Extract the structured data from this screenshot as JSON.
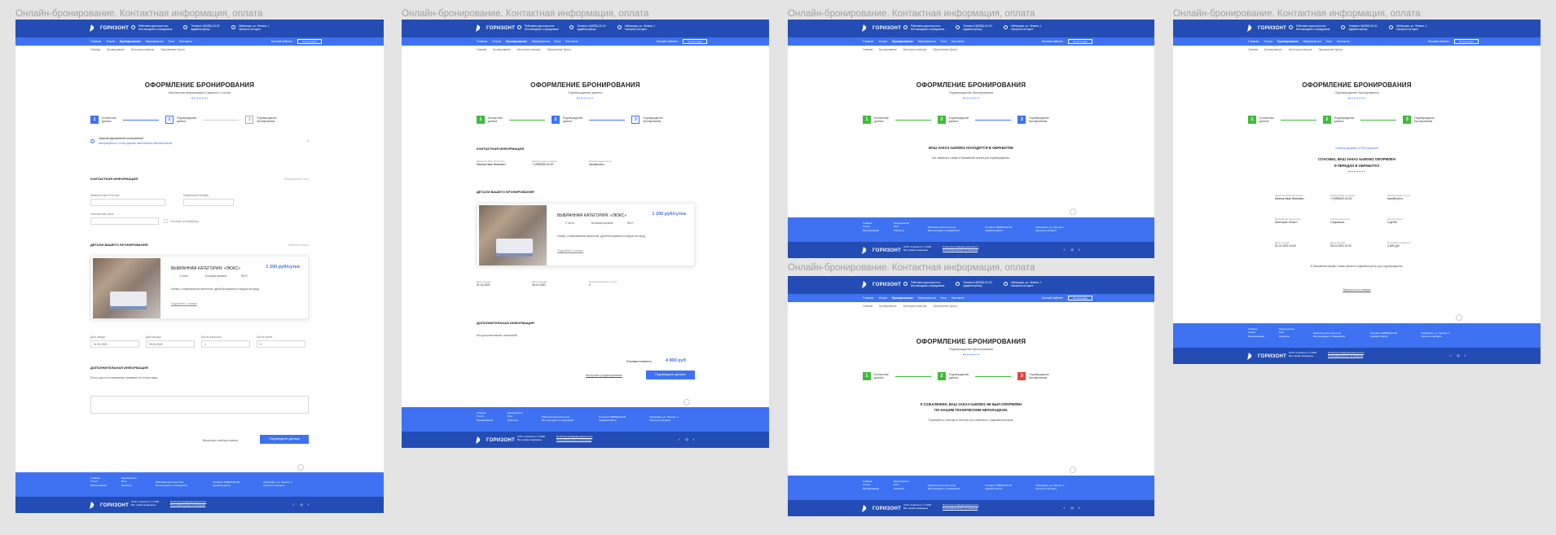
{
  "board_title": "Онлайн-бронирование. Контактная информация, оплата",
  "brand": "ГОРИЗОНТ",
  "header_contacts": [
    {
      "icon": "clock-icon",
      "lines": [
        "Работаем круглосуточно",
        "Без выходных и праздников"
      ]
    },
    {
      "icon": "phone-icon",
      "lines": [
        "Телефон: 8(8352)-00-00",
        "Администратор"
      ]
    },
    {
      "icon": "pin-icon",
      "lines": [
        "Чебоксары, ул. Ленина, 1",
        "Смотреть на карте"
      ]
    }
  ],
  "nav": {
    "items": [
      "Главная",
      "Услуги",
      "Бронирование",
      "Мероприятия",
      "Блог",
      "Контакты"
    ],
    "account": "Личный кабинет",
    "button": "Регистрация"
  },
  "breadcrumbs": [
    "Главная",
    "Бронирование",
    "Категории номеров",
    "Оформление брони"
  ],
  "page1": {
    "title": "ОФОРМЛЕНИЕ БРОНИРОВАНИЯ",
    "subtitle": "Контактная информация и данные о гостях",
    "steps": [
      {
        "num": "1",
        "label": [
          "Контактные",
          "данные"
        ]
      },
      {
        "num": "2",
        "label": [
          "Подтверждение",
          "данных"
        ]
      },
      {
        "num": "3",
        "label": [
          "Подтверждение",
          "бронирования"
        ]
      }
    ],
    "notice_title": "Зарегистрированный пользователь?",
    "notice_text": "Авторизуйтесь, чтобы данные заполнились автоматически",
    "contact_section": "КОНТАКТНАЯ ИНФОРМАЦИЯ",
    "contact_hint": "Обязательные поля",
    "name_label": "Фамилия Имя Отчество",
    "phone_label": "Мобильный телефон",
    "email_label": "Электронная почта",
    "consent": "Согласие на обработку",
    "details_section": "ДЕТАЛИ ВАШЕГО БРОНИРОВАНИЯ",
    "details_link": "Изменить выбор",
    "room_title": "ВЫБРАННАЯ КАТЕГОРИЯ: «ЛЮКС»",
    "room_price": "1 200 руб/сутки",
    "room_features": [
      "2 гостя",
      "Большая кровать",
      "Wi-Fi"
    ],
    "room_desc": "Номер с современным ремонтом, удобной кроватью и видом на город.",
    "room_more": "Подробнее о номере",
    "date_fields": [
      {
        "label": "Дата заезда",
        "value": "01.01.2020"
      },
      {
        "label": "Дата выезда",
        "value": "05.01.2020"
      },
      {
        "label": "Кол-во взрослых",
        "value": "1"
      },
      {
        "label": "Кол-во детей",
        "value": "0"
      }
    ],
    "extra_section": "ДОПОЛНИТЕЛЬНАЯ ИНФОРМАЦИЯ",
    "extra_text": "Если у вас есть пожелания, напишите их в поле ниже.",
    "back_link": "Вернуться к выбору номера",
    "submit": "Подтвердите данные"
  },
  "page2": {
    "title": "ОФОРМЛЕНИЕ БРОНИРОВАНИЯ",
    "subtitle": "Подтверждение данных",
    "contact_section": "КОНТАКТНАЯ ИНФОРМАЦИЯ",
    "contact_cols": [
      {
        "k": "Фамилия Имя Отчество",
        "v": "Иванов Иван Иванович"
      },
      {
        "k": "Мобильный телефон",
        "v": "+7(999)000-00-00"
      },
      {
        "k": "Электронная почта",
        "v": "ivan@mail.ru"
      }
    ],
    "details_section": "ДЕТАЛИ ВАШЕГО БРОНИРОВАНИЯ",
    "room_title": "ВЫБРАННАЯ КАТЕГОРИЯ: «ЛЮКС»",
    "room_price": "1 200 руб/сутки",
    "dates": [
      {
        "k": "Дата заезда",
        "v": "01.01.2020"
      },
      {
        "k": "Дата выезда",
        "v": "05.01.2020"
      },
      {
        "k": "Кол-во взрослых гостей",
        "v": "2"
      }
    ],
    "extra_section": "ДОПОЛНИТЕЛЬНАЯ ИНФОРМАЦИЯ",
    "extra_text": "Без дополнительных пожеланий",
    "total_label": "Итоговая стоимость:",
    "total_value": "4 800 руб",
    "back_link": "Вернуться к редактированию",
    "submit": "Подтвердите данные"
  },
  "page3": {
    "title": "ОФОРМЛЕНИЕ БРОНИРОВАНИЯ",
    "subtitle": "Подтверждение бронирования",
    "status": "ВАШ ЗАКАЗ №000001 НАХОДИТСЯ В ОБРАБОТКЕ",
    "status_text": "Мы свяжемся с вами в ближайшее время для подтверждения."
  },
  "page4": {
    "title": "ОФОРМЛЕНИЕ БРОНИРОВАНИЯ",
    "subtitle": "Подтверждение бронирования",
    "status": "К СОЖАЛЕНИЮ, ВАШ ЗАКАЗ №000001 НЕ БЫЛ ОФОРМЛЕН",
    "status2": "ПО НАШИМ ТЕХНИЧЕСКИМ НЕПОЛАДКАМ.",
    "status_text": "Пожалуйста, повторите попытку или свяжитесь с администратором."
  },
  "page5": {
    "title": "ОФОРМЛЕНИЕ БРОНИРОВАНИЯ",
    "subtitle": "Подтверждение бронирования",
    "download": "Скачать документ в PDF-формате",
    "status": "СПАСИБО, ВАШ ЗАКАЗ №000001 ОФОРМЛЕН",
    "status2": "И ПЕРЕДАН В ОБРАБОТКУ",
    "rows": [
      [
        {
          "k": "Фамилия Имя Отчество",
          "v": "Иванов Иван Иванович"
        },
        {
          "k": "Мобильный телефон",
          "v": "+7(999)000-00-00"
        },
        {
          "k": "Электронная почта",
          "v": "ivan@mail.ru"
        }
      ],
      [
        {
          "k": "Выбранная категория",
          "v": "Категория «Люкс»"
        },
        {
          "k": "Кол-во взрослых",
          "v": "2 взрослых"
        },
        {
          "k": "Кол-во детей",
          "v": "0 детей"
        }
      ],
      [
        {
          "k": "Дата заезда",
          "v": "01.01.2020 14:00"
        },
        {
          "k": "Дата выезда",
          "v": "05.01.2020 12:00"
        },
        {
          "k": "Итоговая стоимость",
          "v": "4 800 руб"
        }
      ]
    ],
    "note": "В ближайшее время с вами свяжется администратор для подтверждения.",
    "back_link": "Вернуться на главную"
  },
  "footer": {
    "menu1": [
      "Главная",
      "Услуги",
      "Бронирование"
    ],
    "menu2": [
      "Мероприятия",
      "Блог",
      "Контакты"
    ],
    "address": [
      "ООО «Горизонт» © 2020",
      "Все права защищены"
    ],
    "policy": [
      "Политика конфиденциальности",
      "Пользовательское соглашение"
    ],
    "social": [
      "vk-icon",
      "instagram-icon",
      "facebook-icon"
    ]
  }
}
